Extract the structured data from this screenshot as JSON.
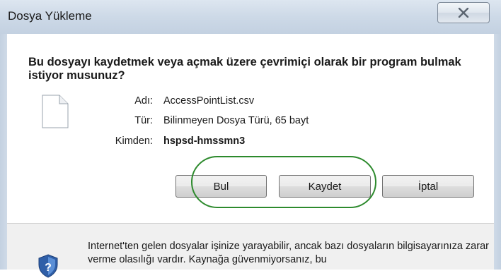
{
  "dialog": {
    "title": "Dosya Yükleme",
    "question": "Bu dosyayı kaydetmek veya açmak üzere çevrimiçi olarak bir program bulmak istiyor musunuz?",
    "fields": [
      {
        "label": "Adı:",
        "value": "AccessPointList.csv"
      },
      {
        "label": "Tür:",
        "value": "Bilinmeyen Dosya Türü, 65 bayt"
      },
      {
        "label": "Kimden:",
        "value": "hspsd-hmssmn3"
      }
    ],
    "buttons": {
      "find": "Bul",
      "save": "Kaydet",
      "cancel": "İptal"
    },
    "warning": "Internet'ten gelen dosyalar işinize yarayabilir, ancak bazı dosyaların bilgisayarınıza zarar verme olasılığı vardır. Kaynağa güvenmiyorsanız, bu"
  },
  "colors": {
    "highlight": "#2d8a2d",
    "titlebar": "#cdd9e7"
  },
  "icons": {
    "close": "close-icon",
    "file": "file-icon",
    "shield": "shield-icon"
  }
}
